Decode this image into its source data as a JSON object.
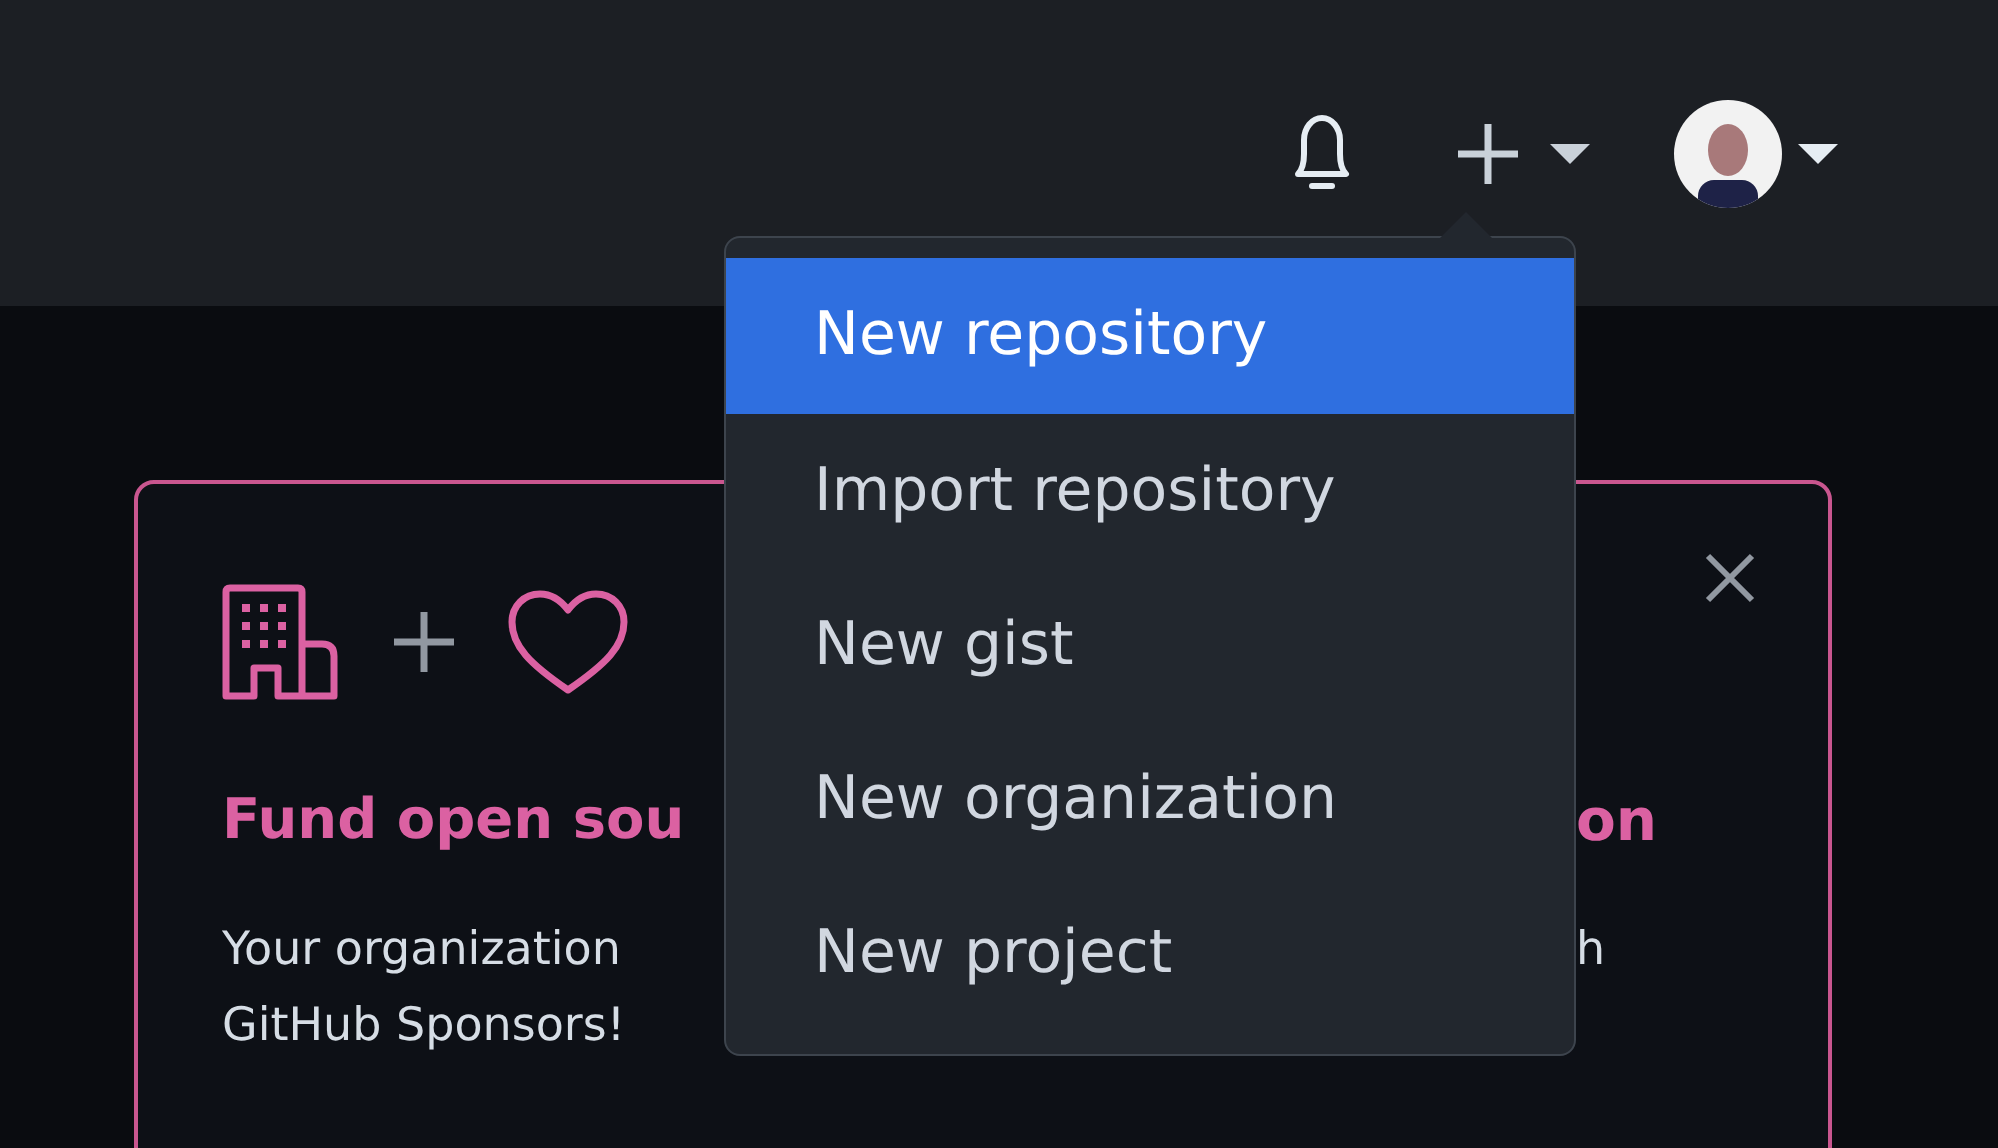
{
  "menu": {
    "items": [
      {
        "label": "New repository",
        "selected": true
      },
      {
        "label": "Import repository",
        "selected": false
      },
      {
        "label": "New gist",
        "selected": false
      },
      {
        "label": "New organization",
        "selected": false
      },
      {
        "label": "New project",
        "selected": false
      }
    ]
  },
  "card": {
    "heading": {
      "left": "Fund open sou",
      "right": "on"
    },
    "body": [
      {
        "left": "Your organization",
        "right": "h"
      },
      {
        "left": "GitHub Sponsors!"
      }
    ]
  }
}
